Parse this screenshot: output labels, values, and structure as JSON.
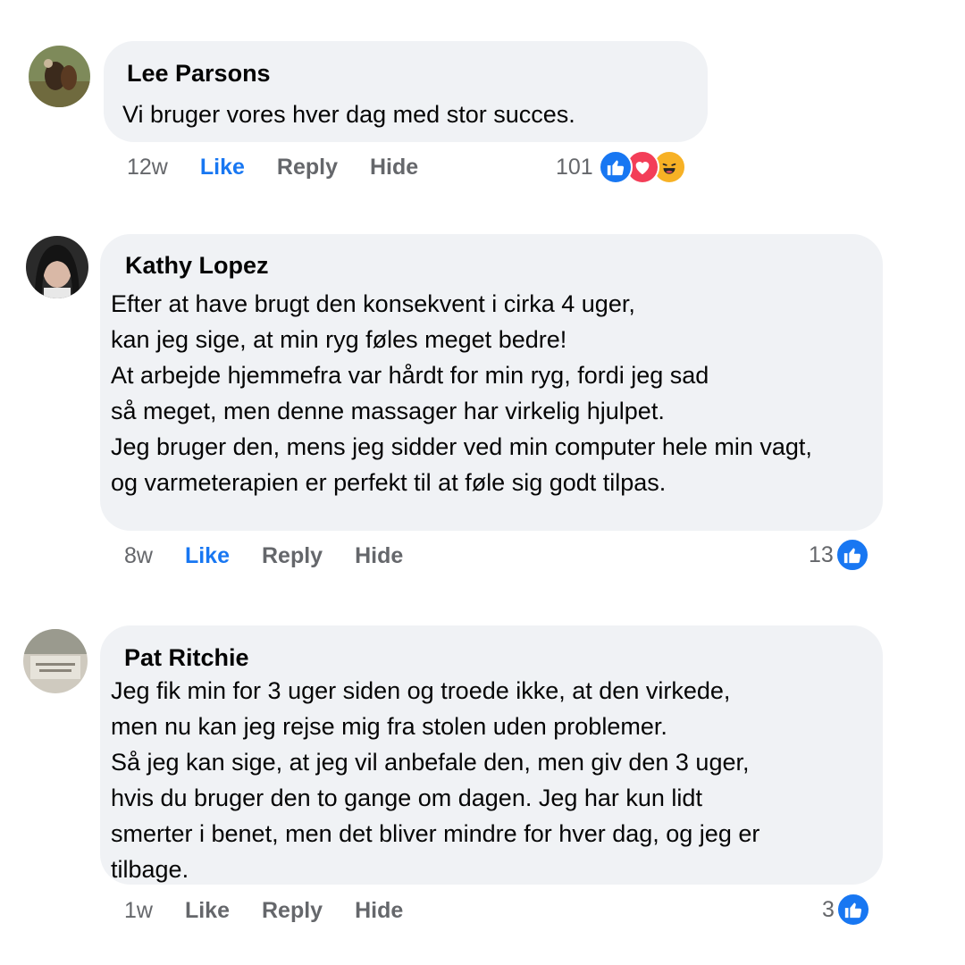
{
  "comments": [
    {
      "author": "Lee Parsons",
      "lines": [
        "Vi bruger vores hver dag med stor succes."
      ],
      "time": "12w",
      "like_label": "Like",
      "like_active": true,
      "reply_label": "Reply",
      "hide_label": "Hide",
      "reaction_count": "101",
      "reactions": [
        "like-icon",
        "love-icon",
        "haha-icon"
      ]
    },
    {
      "author": "Kathy Lopez",
      "lines": [
        "Efter at have brugt den konsekvent i cirka 4 uger,",
        "kan jeg sige, at min ryg føles meget bedre!",
        "At arbejde hjemmefra var hårdt for min ryg, fordi jeg sad",
        "så meget, men denne massager har virkelig hjulpet.",
        "Jeg bruger den, mens jeg sidder ved min computer hele min vagt,",
        "og varmeterapien er perfekt til at føle sig godt tilpas."
      ],
      "time": "8w",
      "like_label": "Like",
      "like_active": true,
      "reply_label": "Reply",
      "hide_label": "Hide",
      "reaction_count": "13",
      "reactions": [
        "like-icon"
      ]
    },
    {
      "author": "Pat Ritchie",
      "lines": [
        "Jeg fik min for 3 uger siden og troede ikke, at den virkede,",
        "men nu kan jeg rejse mig fra stolen uden problemer.",
        "Så jeg kan sige, at jeg vil anbefale den, men giv den 3 uger,",
        "hvis du bruger den to gange om dagen. Jeg har kun lidt",
        "smerter i benet, men det bliver mindre for hver dag, og jeg er",
        "tilbage."
      ],
      "time": "1w",
      "like_label": "Like",
      "like_active": false,
      "reply_label": "Reply",
      "hide_label": "Hide",
      "reaction_count": "3",
      "reactions": [
        "like-icon"
      ]
    }
  ],
  "colors": {
    "bubble": "#f0f2f5",
    "link_blue": "#1877f2",
    "muted": "#65676b"
  }
}
